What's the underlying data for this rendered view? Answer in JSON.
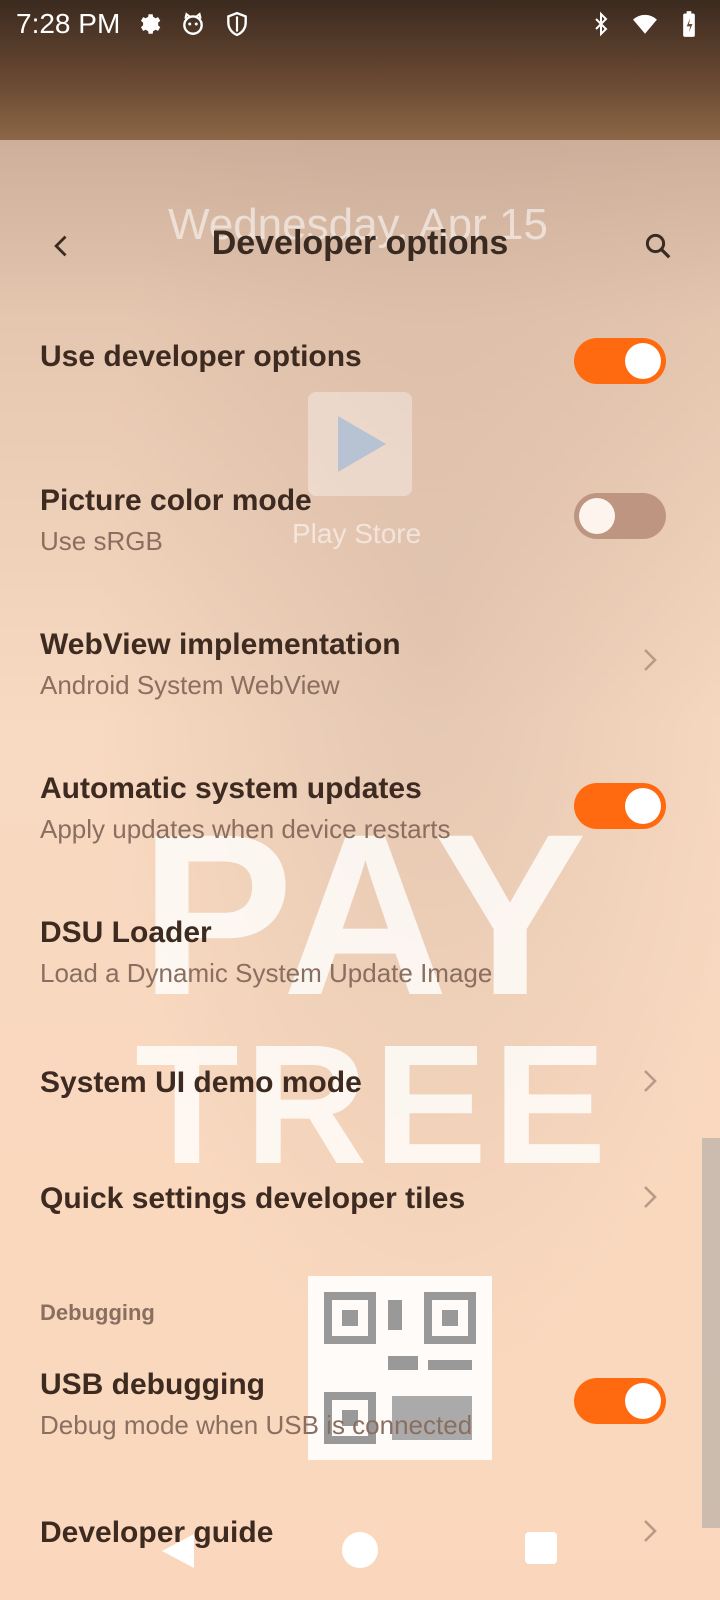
{
  "status_bar": {
    "time": "7:28 PM",
    "left_icons": [
      "settings-gear-icon",
      "cat-face-icon",
      "shield-icon"
    ],
    "right_icons": [
      "bluetooth-icon",
      "wifi-icon",
      "battery-charging-icon"
    ]
  },
  "background_ghost": {
    "date": "Wednesday, Apr 15",
    "app_label": "Play Store",
    "watermark_line1": "PAY",
    "watermark_line2": "TREE"
  },
  "toolbar": {
    "title": "Developer options",
    "back_icon": "back-arrow-icon",
    "search_icon": "search-icon"
  },
  "settings": [
    {
      "title": "Use developer options",
      "subtitle": "",
      "control": "toggle",
      "on": true
    },
    {
      "title": "Picture color mode",
      "subtitle": "Use sRGB",
      "control": "toggle",
      "on": false
    },
    {
      "title": "WebView implementation",
      "subtitle": "Android System WebView",
      "control": "chevron"
    },
    {
      "title": "Automatic system updates",
      "subtitle": "Apply updates when device restarts",
      "control": "toggle",
      "on": true
    },
    {
      "title": "DSU Loader",
      "subtitle": "Load a Dynamic System Update Image",
      "control": "none"
    },
    {
      "title": "System UI demo mode",
      "subtitle": "",
      "control": "chevron"
    },
    {
      "title": "Quick settings developer tiles",
      "subtitle": "",
      "control": "chevron"
    }
  ],
  "debugging": {
    "section_label": "Debugging",
    "items": [
      {
        "title": "USB debugging",
        "subtitle": "Debug mode when USB is connected",
        "control": "toggle",
        "on": true
      },
      {
        "title": "Developer guide",
        "subtitle": "",
        "control": "chevron"
      }
    ]
  },
  "nav_bar": {
    "icons": [
      "nav-back-icon",
      "nav-home-icon",
      "nav-recents-icon"
    ]
  },
  "colors": {
    "accent": "#ff6a10",
    "toggle_off": "#bd9580",
    "title_text": "#3a2b22"
  }
}
